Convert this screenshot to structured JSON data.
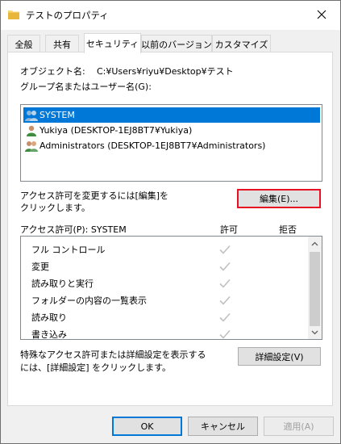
{
  "window": {
    "title": "テストのプロパティ",
    "close_label": "close"
  },
  "tabs": [
    {
      "label": "全般",
      "active": false
    },
    {
      "label": "共有",
      "active": false
    },
    {
      "label": "セキュリティ",
      "active": true
    },
    {
      "label": "以前のバージョン",
      "active": false
    },
    {
      "label": "カスタマイズ",
      "active": false
    }
  ],
  "security": {
    "object_name_label": "オブジェクト名:",
    "object_name_value": "C:¥Users¥riyu¥Desktop¥テスト",
    "group_label": "グループ名またはユーザー名(G):",
    "users": [
      {
        "name": "SYSTEM",
        "selected": true
      },
      {
        "name": "Yukiya (DESKTOP-1EJ8BT7¥Yukiya)",
        "selected": false
      },
      {
        "name": "Administrators (DESKTOP-1EJ8BT7¥Administrators)",
        "selected": false
      }
    ],
    "edit_hint_line1": "アクセス許可を変更するには[編集]を",
    "edit_hint_line2": "クリックします。",
    "edit_button": "編集(E)...",
    "permissions_header": "アクセス許可(P): SYSTEM",
    "allow_header": "許可",
    "deny_header": "拒否",
    "permissions": [
      {
        "name": "フル コントロール",
        "allow": true,
        "deny": false
      },
      {
        "name": "変更",
        "allow": true,
        "deny": false
      },
      {
        "name": "読み取りと実行",
        "allow": true,
        "deny": false
      },
      {
        "name": "フォルダーの内容の一覧表示",
        "allow": true,
        "deny": false
      },
      {
        "name": "読み取り",
        "allow": true,
        "deny": false
      },
      {
        "name": "書き込み",
        "allow": true,
        "deny": false
      }
    ],
    "advanced_hint_line1": "特殊なアクセス許可または詳細設定を表示するには、",
    "advanced_hint_line1_visible": "特殊なアクセス許可または詳細設定を表示する",
    "advanced_hint_line2": "には、[詳細設定] をクリックします。",
    "advanced_button": "詳細設定(V)"
  },
  "footer": {
    "ok": "OK",
    "cancel": "キャンセル",
    "apply": "適用(A)"
  },
  "colors": {
    "selection": "#0078d7",
    "focus_border": "#e81123",
    "check": "#c0c0c0"
  }
}
